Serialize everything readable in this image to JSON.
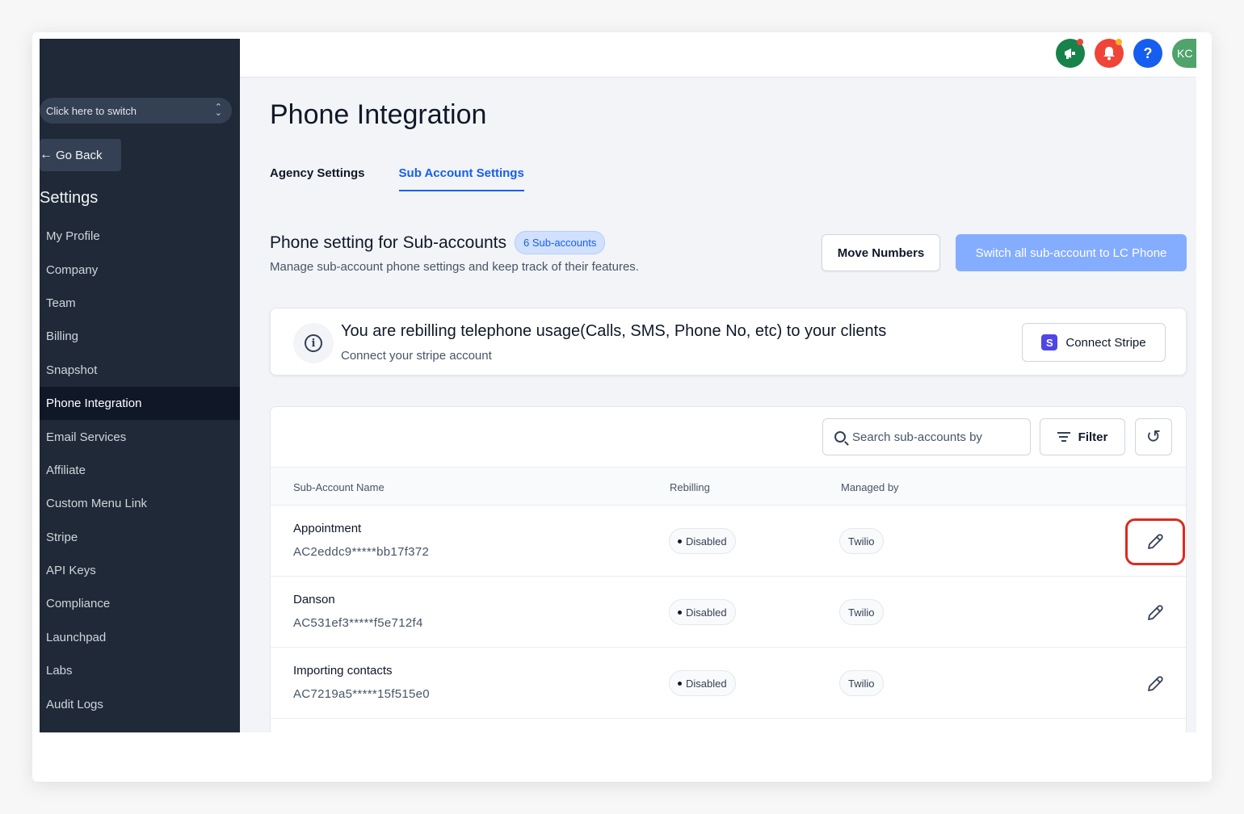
{
  "sidebar": {
    "switcher_label": "Click here to switch",
    "go_back_label": "Go Back",
    "settings_title": "Settings",
    "items": [
      {
        "label": "My Profile"
      },
      {
        "label": "Company"
      },
      {
        "label": "Team"
      },
      {
        "label": "Billing"
      },
      {
        "label": "Snapshot"
      },
      {
        "label": "Phone Integration",
        "active": true
      },
      {
        "label": "Email Services"
      },
      {
        "label": "Affiliate"
      },
      {
        "label": "Custom Menu Link"
      },
      {
        "label": "Stripe"
      },
      {
        "label": "API Keys"
      },
      {
        "label": "Compliance"
      },
      {
        "label": "Launchpad"
      },
      {
        "label": "Labs"
      },
      {
        "label": "Audit Logs"
      }
    ]
  },
  "topbar": {
    "icons": [
      "megaphone-icon",
      "bell-icon",
      "help-icon"
    ],
    "avatar_initials": "KC",
    "help_glyph": "?"
  },
  "page": {
    "title": "Phone Integration",
    "tabs": [
      {
        "label": "Agency Settings",
        "active": false
      },
      {
        "label": "Sub Account Settings",
        "active": true
      }
    ]
  },
  "section": {
    "title": "Phone setting for Sub-accounts",
    "count_badge": "6 Sub-accounts",
    "subtitle": "Manage sub-account phone settings and keep track of their features.",
    "move_numbers_label": "Move Numbers",
    "switch_all_label": "Switch all sub-account to LC Phone"
  },
  "alert": {
    "title": "You are rebilling telephone usage(Calls, SMS, Phone No, etc) to your clients",
    "subtitle": "Connect your stripe account",
    "connect_label": "Connect Stripe",
    "stripe_glyph": "S",
    "info_glyph": "i"
  },
  "table": {
    "search_placeholder": "Search sub-accounts by",
    "filter_label": "Filter",
    "columns": {
      "name": "Sub-Account Name",
      "rebilling": "Rebilling",
      "managed_by": "Managed by"
    },
    "rows": [
      {
        "name": "Appointment",
        "sid": "AC2eddc9*****bb17f372",
        "rebilling": "Disabled",
        "managed_by": "Twilio",
        "highlighted": true
      },
      {
        "name": "Danson",
        "sid": "AC531ef3*****f5e712f4",
        "rebilling": "Disabled",
        "managed_by": "Twilio",
        "highlighted": false
      },
      {
        "name": "Importing contacts",
        "sid": "AC7219a5*****15f515e0",
        "rebilling": "Disabled",
        "managed_by": "Twilio",
        "highlighted": false
      }
    ]
  },
  "colors": {
    "sidebar_bg": "#1f2937",
    "accent": "#155eef",
    "switch_button": "#84adff",
    "highlight_outline": "#d92d20"
  }
}
